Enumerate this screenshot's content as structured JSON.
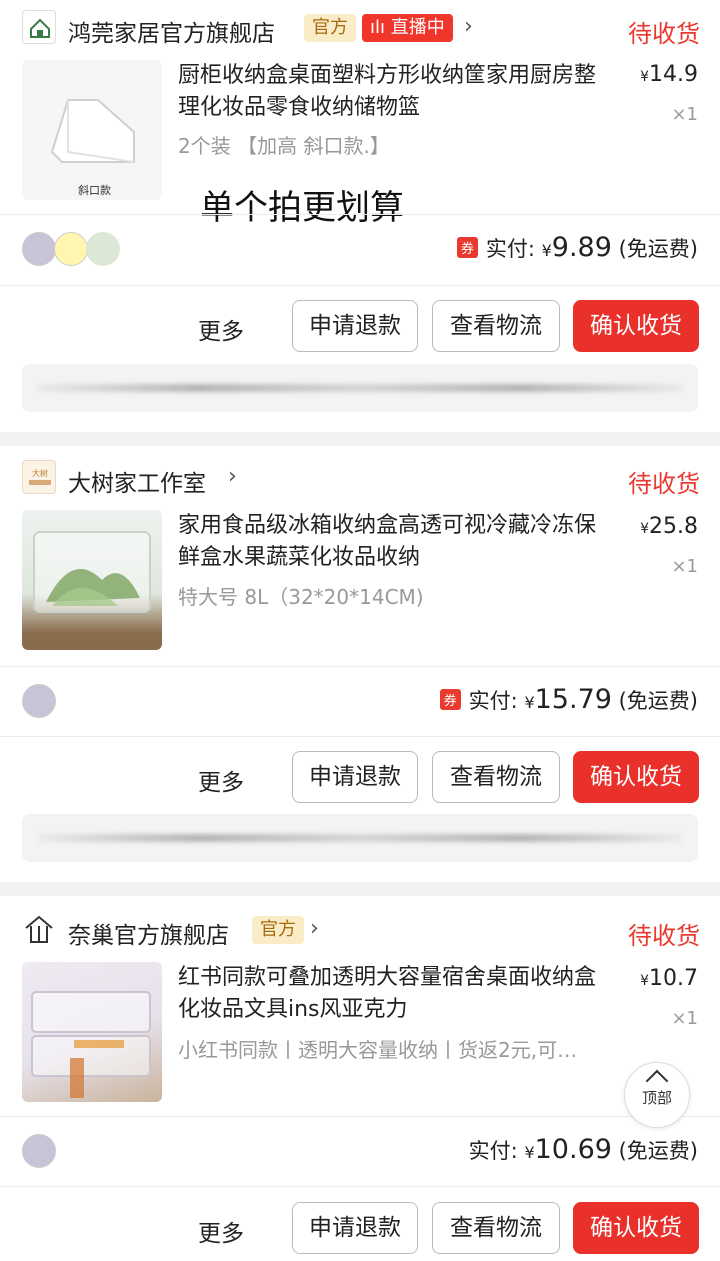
{
  "colors": {
    "accent": "#e83a2f",
    "official_tag_bg": "#fbecc8",
    "official_tag_text": "#a66a10"
  },
  "orders": [
    {
      "shop_name": "鸿莞家居官方旗舰店",
      "official_tag": "官方",
      "live_tag": "直播中",
      "status": "待收货",
      "product_title": "厨柜收纳盒桌面塑料方形收纳筐家用厨房整理化妆品零食收纳储物篮",
      "spec": "2个装 【加高 斜口款.】",
      "price_symbol": "¥",
      "price": "14.9",
      "qty": "×1",
      "promo_text": "单个拍更划算",
      "coupon": "券",
      "paid_label": "实付:",
      "paid_symbol": "¥",
      "paid_amount": "9.89",
      "shipping": "(免运费)",
      "thumb_label": "斜口款"
    },
    {
      "shop_name": "大树家工作室",
      "status": "待收货",
      "product_title": "家用食品级冰箱收纳盒高透可视冷藏冷冻保鲜盒水果蔬菜化妆品收纳",
      "spec": "特大号 8L（32*20*14CM)",
      "price_symbol": "¥",
      "price": "25.8",
      "qty": "×1",
      "coupon": "券",
      "paid_label": "实付:",
      "paid_symbol": "¥",
      "paid_amount": "15.79",
      "shipping": "(免运费)"
    },
    {
      "shop_name": "奈巢官方旗舰店",
      "official_tag": "官方",
      "status": "待收货",
      "product_title": "红书同款可叠加透明大容量宿舍桌面收纳盒化妆品文具ins风亚克力",
      "spec": "小红书同款丨透明大容量收纳丨货返2元,可…",
      "price_symbol": "¥",
      "price": "10.7",
      "qty": "×1",
      "paid_label": "实付:",
      "paid_symbol": "¥",
      "paid_amount": "10.69",
      "shipping": "(免运费)"
    }
  ],
  "actions": {
    "more": "更多",
    "refund": "申请退款",
    "logistics": "查看物流",
    "confirm": "确认收货"
  },
  "back_to_top": "顶部"
}
